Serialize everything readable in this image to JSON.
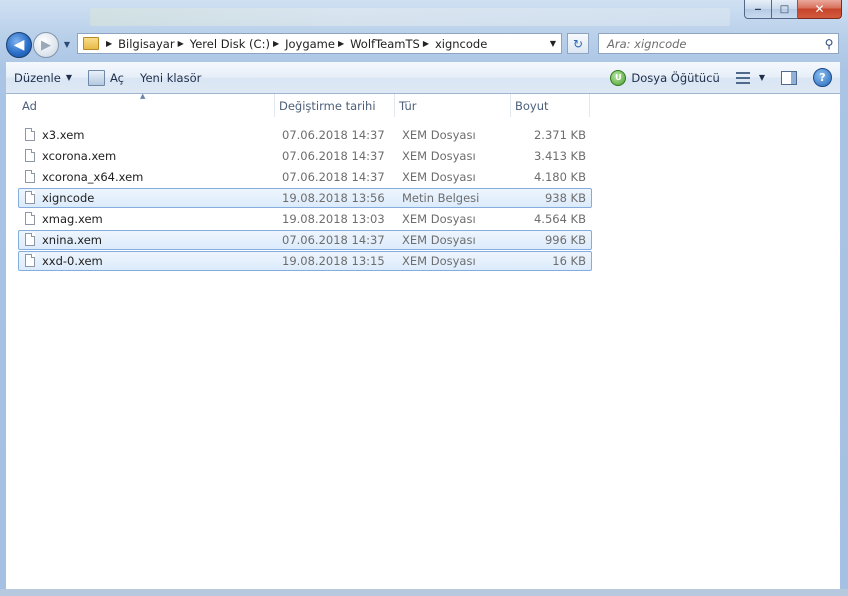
{
  "window": {
    "caption": {
      "minimize": "‒",
      "maximize": "□",
      "close": "✕"
    }
  },
  "nav": {
    "back_glyph": "◀",
    "forward_glyph": "▶",
    "recent_glyph": "▼",
    "breadcrumbs": [
      "Bilgisayar",
      "Yerel Disk (C:)",
      "Joygame",
      "WolfTeamTS",
      "xigncode"
    ],
    "breadcrumb_separator": "▶",
    "address_dropdown_glyph": "▼",
    "refresh_glyph": "↻"
  },
  "search": {
    "placeholder": "Ara: xigncode",
    "icon": "search-icon"
  },
  "toolbar": {
    "organize": "Düzenle",
    "open": "Aç",
    "new_folder": "Yeni klasör",
    "advisor": "Dosya Öğütücü",
    "advisor_glyph": "U",
    "help_glyph": "?",
    "caret": "▼"
  },
  "columns": {
    "name": "Ad",
    "date": "Değiştirme tarihi",
    "type": "Tür",
    "size": "Boyut",
    "sort_glyph": "▲"
  },
  "files": [
    {
      "name": "x3.xem",
      "date": "07.06.2018 14:37",
      "type": "XEM Dosyası",
      "size": "2.371 KB",
      "selected": false
    },
    {
      "name": "xcorona.xem",
      "date": "07.06.2018 14:37",
      "type": "XEM Dosyası",
      "size": "3.413 KB",
      "selected": false
    },
    {
      "name": "xcorona_x64.xem",
      "date": "07.06.2018 14:37",
      "type": "XEM Dosyası",
      "size": "4.180 KB",
      "selected": false
    },
    {
      "name": "xigncode",
      "date": "19.08.2018 13:56",
      "type": "Metin Belgesi",
      "size": "938 KB",
      "selected": true
    },
    {
      "name": "xmag.xem",
      "date": "19.08.2018 13:03",
      "type": "XEM Dosyası",
      "size": "4.564 KB",
      "selected": false
    },
    {
      "name": "xnina.xem",
      "date": "07.06.2018 14:37",
      "type": "XEM Dosyası",
      "size": "996 KB",
      "selected": true
    },
    {
      "name": "xxd-0.xem",
      "date": "19.08.2018 13:15",
      "type": "XEM Dosyası",
      "size": "16 KB",
      "selected": true
    }
  ],
  "colors": {
    "selection": "#dcebfc",
    "selection_border": "#84acdd",
    "frame": "#a9c4e4"
  }
}
